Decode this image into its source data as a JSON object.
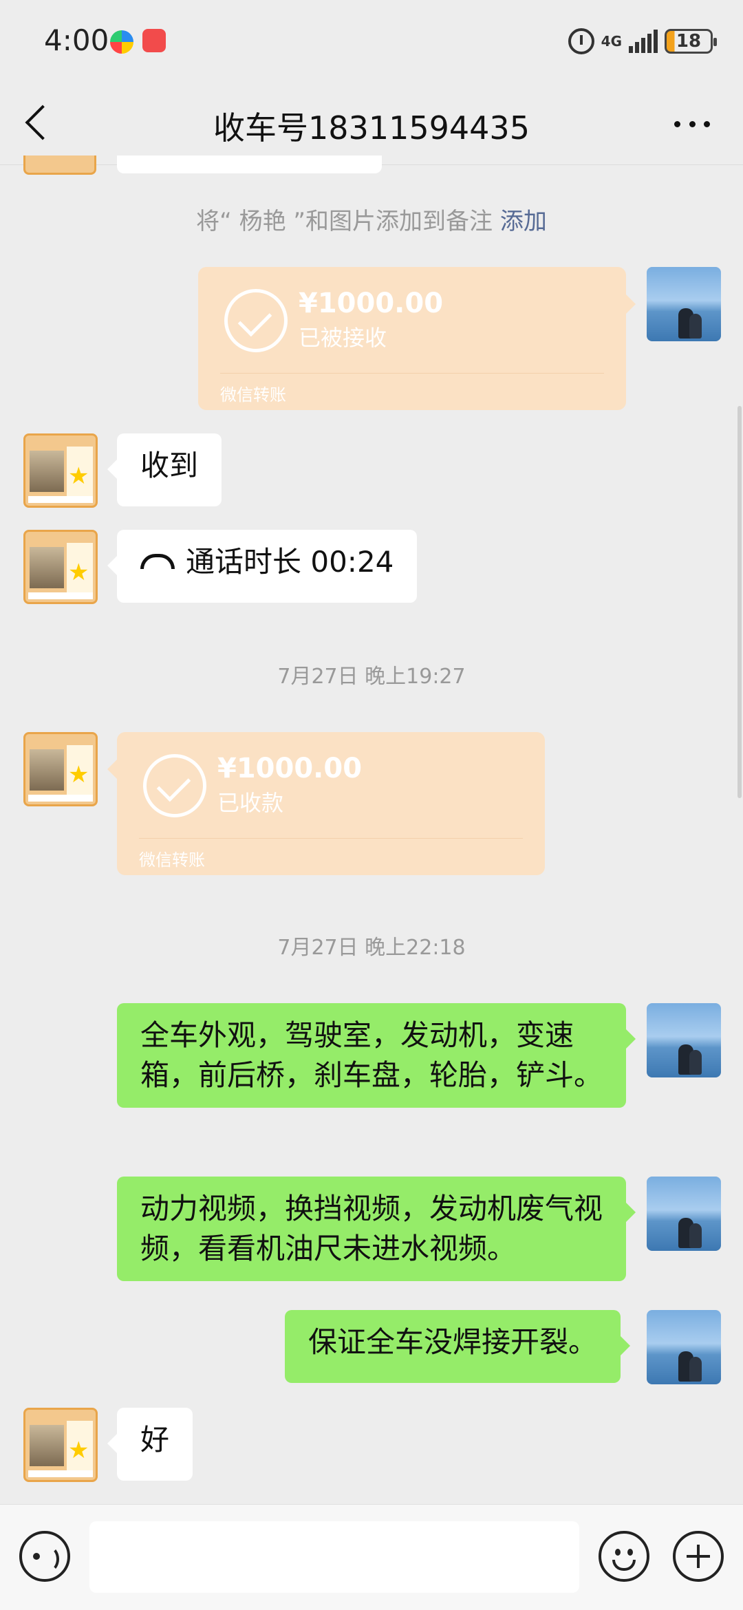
{
  "status_bar": {
    "time": "4:00",
    "network": "4G",
    "battery": "18"
  },
  "header": {
    "title": "收车号18311594435"
  },
  "system_note": {
    "text": "将“ 杨艳 ”和图片添加到备注 ",
    "action": "添加"
  },
  "transfer_sent": {
    "amount": "¥1000.00",
    "status": "已被接收",
    "footer": "微信转账"
  },
  "msg_received_1": "收到",
  "call_record": "通话时长 00:24",
  "timestamp_1": "7月27日 晚上19:27",
  "transfer_received": {
    "amount": "¥1000.00",
    "status": "已收款",
    "footer": "微信转账"
  },
  "timestamp_2": "7月27日 晚上22:18",
  "msg_sent_1": "全车外观，驾驶室，发动机，变速箱，前后桥，刹车盘，轮胎，铲斗。",
  "msg_sent_2": "动力视频，换挡视频，发动机废气视频，看看机油尺未进水视频。",
  "msg_sent_3": "保证全车没焊接开裂。",
  "msg_received_2": "好",
  "input": {
    "placeholder": ""
  }
}
